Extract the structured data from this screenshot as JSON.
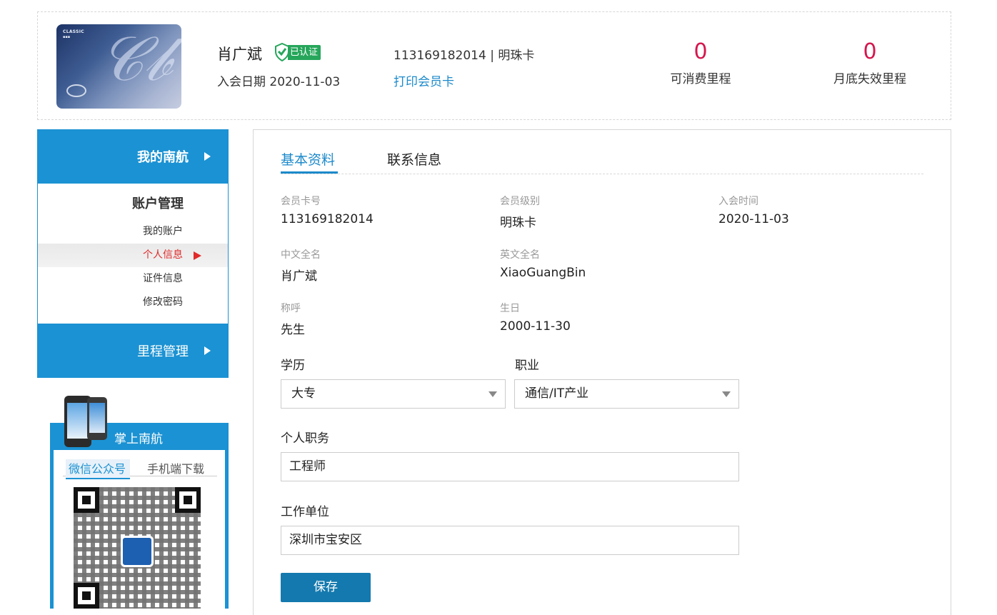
{
  "header": {
    "card_text": "CLASSIC",
    "member_name": "肖广斌",
    "verified_label": "已认证",
    "join_date": "入会日期 2020-11-03",
    "card_number_tier": "113169182014 | 明珠卡",
    "print_card": "打印会员卡",
    "stats": [
      {
        "value": "0",
        "label": "可消费里程"
      },
      {
        "value": "0",
        "label": "月底失效里程"
      }
    ]
  },
  "sidebar": {
    "title": "我的南航",
    "section": "账户管理",
    "items": [
      {
        "label": "我的账户"
      },
      {
        "label": "个人信息"
      },
      {
        "label": "证件信息"
      },
      {
        "label": "修改密码"
      }
    ],
    "footer": "里程管理"
  },
  "promo": {
    "title": "掌上南航",
    "tabs": [
      "微信公众号",
      "手机端下载"
    ]
  },
  "tabs": [
    "基本资料",
    "联系信息"
  ],
  "fields": [
    {
      "label": "会员卡号",
      "value": "113169182014"
    },
    {
      "label": "会员级别",
      "value": "明珠卡"
    },
    {
      "label": "入会时间",
      "value": "2020-11-03"
    },
    {
      "label": "中文全名",
      "value": "肖广斌"
    },
    {
      "label": "英文全名",
      "value": "XiaoGuangBin"
    },
    {
      "label": "称呼",
      "value": "先生"
    },
    {
      "label": "生日",
      "value": "2000-11-30"
    }
  ],
  "form": {
    "education": {
      "label": "学历",
      "value": "大专"
    },
    "occupation": {
      "label": "职业",
      "value": "通信/IT产业"
    },
    "position": {
      "label": "个人职务",
      "value": "工程师"
    },
    "employer": {
      "label": "工作单位",
      "value": "深圳市宝安区"
    },
    "save_label": "保存"
  },
  "colors": {
    "accent": "#1b92d3",
    "link": "#1d8acb",
    "stat": "#d5164d",
    "active_nav": "#e12a2a",
    "verified": "#26a65b"
  }
}
